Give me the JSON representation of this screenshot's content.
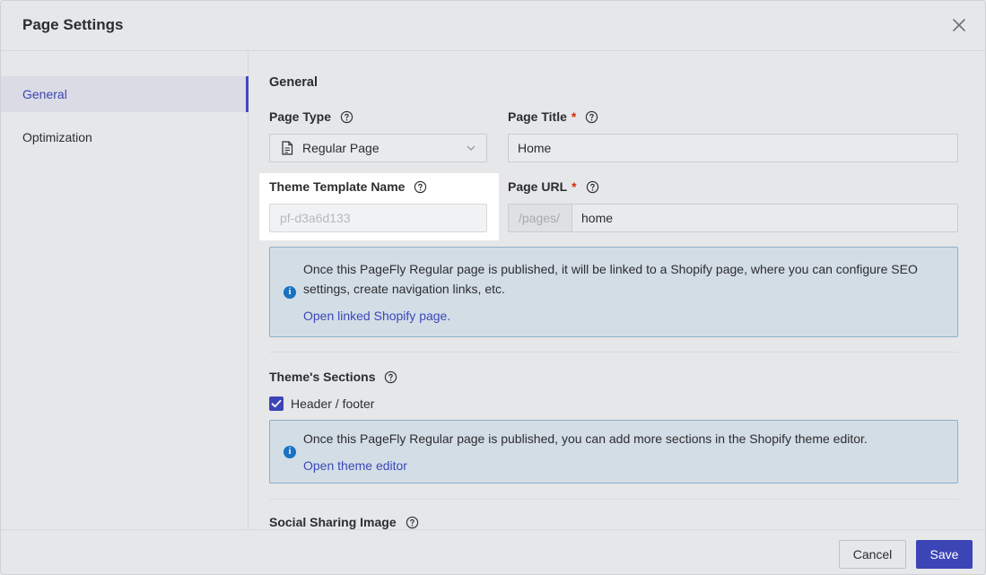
{
  "header": {
    "title": "Page Settings"
  },
  "sidebar": {
    "items": [
      {
        "label": "General"
      },
      {
        "label": "Optimization"
      }
    ]
  },
  "general": {
    "section_title": "General",
    "page_type": {
      "label": "Page Type",
      "value": "Regular Page"
    },
    "page_title": {
      "label": "Page Title",
      "required_mark": "*",
      "value": "Home"
    },
    "theme_template": {
      "label": "Theme Template Name",
      "value": "pf-d3a6d133"
    },
    "page_url": {
      "label": "Page URL",
      "required_mark": "*",
      "prefix": "/pages/",
      "value": "home"
    },
    "banner": {
      "text": "Once this PageFly Regular page is published, it will be linked to a Shopify page, where you can configure SEO settings, create navigation links, etc.",
      "link": "Open linked Shopify page."
    }
  },
  "sections": {
    "title": "Theme's Sections",
    "checkbox_label": "Header / footer",
    "checked": true,
    "banner": {
      "text": "Once this PageFly Regular page is published, you can add more sections in the Shopify theme editor.",
      "link": "Open theme editor"
    }
  },
  "social": {
    "title": "Social Sharing Image"
  },
  "footer": {
    "cancel_label": "Cancel",
    "save_label": "Save"
  },
  "colors": {
    "accent": "#3c45b5",
    "link": "#3c48b8",
    "required": "#d72c0d",
    "info": "#1971c2"
  }
}
